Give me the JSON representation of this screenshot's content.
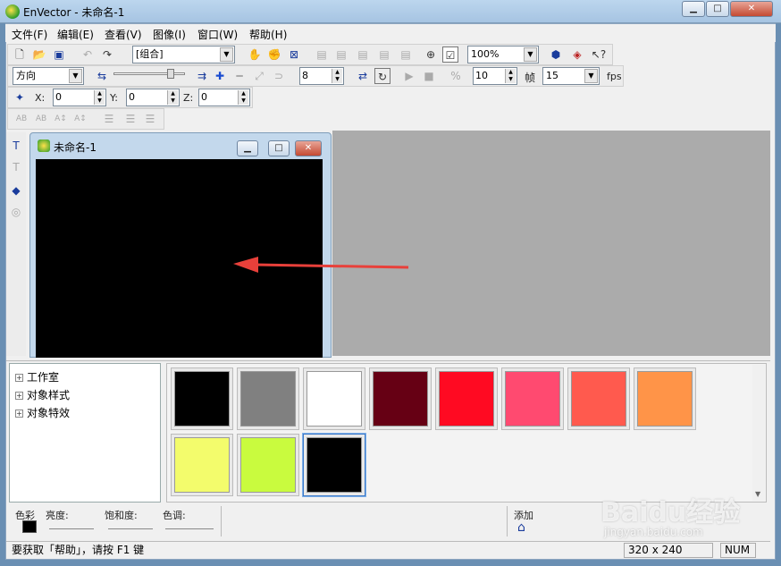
{
  "window": {
    "title": "EnVector - 未命名-1"
  },
  "menu": {
    "items": [
      {
        "label": "文件(F)"
      },
      {
        "label": "编辑(E)"
      },
      {
        "label": "查看(V)"
      },
      {
        "label": "图像(I)"
      },
      {
        "label": "窗口(W)"
      },
      {
        "label": "帮助(H)"
      }
    ]
  },
  "toolbar1": {
    "group_combo": "[组合]",
    "zoom_combo": "100%"
  },
  "toolbar2": {
    "direction_combo": "方向",
    "step_value": "8",
    "frames_value": "10",
    "frame_label": "帧",
    "fps_value": "15",
    "fps_label": "fps"
  },
  "toolbar3": {
    "x_label": "X:",
    "x_value": "0",
    "y_label": "Y:",
    "y_value": "0",
    "z_label": "Z:",
    "z_value": "0"
  },
  "child_window": {
    "title": "未命名-1"
  },
  "tree": {
    "items": [
      {
        "label": "工作室"
      },
      {
        "label": "对象样式"
      },
      {
        "label": "对象特效"
      }
    ]
  },
  "palette": {
    "swatches": [
      {
        "color": "#000000"
      },
      {
        "color": "#808080"
      },
      {
        "color": "#ffffff"
      },
      {
        "color": "#660014"
      },
      {
        "color": "#ff0a22"
      },
      {
        "color": "#ff4a70"
      },
      {
        "color": "#ff5a4e"
      },
      {
        "color": "#ff9448"
      },
      {
        "color": "#f3fc6c"
      },
      {
        "color": "#c9fb3e"
      },
      {
        "color": "#000000",
        "selected": true
      }
    ]
  },
  "color_controls": {
    "color_label": "色彩",
    "brightness_label": "亮度:",
    "saturation_label": "饱和度:",
    "hue_label": "色调:",
    "add_label": "添加",
    "current_color": "#000000"
  },
  "statusbar": {
    "help_text": "要获取「帮助」，请按 F1 键",
    "dimensions": "320 x 240",
    "num": "NUM"
  },
  "watermark": {
    "brand": "Baidu经验",
    "url": "jingyan.baidu.com"
  },
  "colors": {
    "title_bar": "#bcd6ee",
    "mdi_background": "#ababab",
    "canvas": "#000000",
    "arrow": "#e8403a"
  }
}
